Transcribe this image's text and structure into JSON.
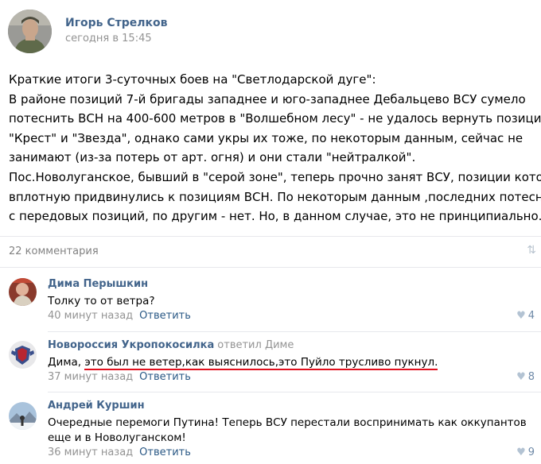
{
  "post": {
    "author": "Игорь Стрелков",
    "time": "сегодня в 15:45",
    "lines": [
      "Краткие итоги 3-суточных боев на \"Светлодарской дуге\":",
      "В районе позиций 7-й бригады западнее и юго-западнее Дебальцево ВСУ сумело",
      "потеснить ВСН на 400-600 метров в \"Волшебном лесу\" - не удалось вернуть позиции",
      "\"Крест\" и \"Звезда\", однако сами укры их тоже, по некоторым данным, сейчас не",
      "занимают (из-за потерь от арт. огня) и они стали \"нейтралкой\".",
      "Пос.Новолуганское, бывший в \"серой зоне\", теперь прочно занят ВСУ, позиции которых",
      "вплотную придвинулись к позициям ВСН. По некоторым данным ,последних потеснили",
      "с передовых позиций, по другим - нет. Но, в данном случае, это не принципиально."
    ]
  },
  "comments_bar": {
    "count_label": "22 комментария",
    "sort_icon": "sort-arrows-icon"
  },
  "comments": [
    {
      "author": "Дима Перышкин",
      "reply_to": "",
      "text": "Толку то от ветра?",
      "time": "40 минут назад",
      "reply_label": "Ответить",
      "likes": "4"
    },
    {
      "author": "Новороссия Укропокосилка",
      "reply_to": "ответил Диме",
      "text_prefix": "Дима, ",
      "text_highlight": "это был не ветер,как выяснилось,это Пуйло трусливо пукнул.",
      "time": "37 минут назад",
      "reply_label": "Ответить",
      "likes": "8"
    },
    {
      "author": "Андрей Куршин",
      "reply_to": "",
      "text": "Очередные перемоги Путина! Теперь ВСУ перестали воспринимать как оккупантов еще и в Новолуганском!",
      "time": "36 минут назад",
      "reply_label": "Ответить",
      "likes": "9"
    }
  ],
  "colors": {
    "link": "#42648b",
    "muted": "#939393",
    "highlight_underline": "#e2101e"
  }
}
